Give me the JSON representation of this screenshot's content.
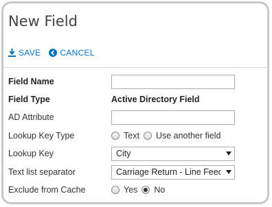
{
  "dialog": {
    "title": "New Field"
  },
  "toolbar": {
    "save_label": "SAVE",
    "save_icon": "download-arrow-icon",
    "cancel_label": "CANCEL",
    "cancel_icon": "circle-left-arrow-icon",
    "accent_color": "#0072c6"
  },
  "form": {
    "field_name": {
      "label": "Field Name",
      "value": ""
    },
    "field_type": {
      "label": "Field Type",
      "value": "Active Directory Field"
    },
    "ad_attribute": {
      "label": "AD Attribute",
      "value": ""
    },
    "lookup_key_type": {
      "label": "Lookup Key Type",
      "options": [
        "Text",
        "Use another field"
      ],
      "selected": ""
    },
    "lookup_key": {
      "label": "Lookup Key",
      "value": "City"
    },
    "text_list_separator": {
      "label": "Text list separator",
      "value": "Carriage Return - Line Feed"
    },
    "exclude_from_cache": {
      "label": "Exclude from Cache",
      "options": [
        "Yes",
        "No"
      ],
      "selected": "No"
    }
  }
}
